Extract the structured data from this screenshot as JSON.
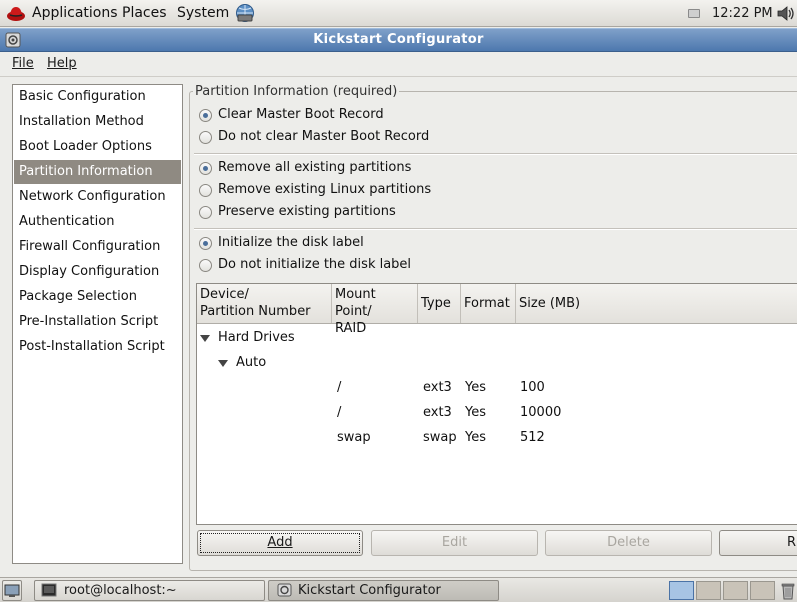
{
  "topbar": {
    "menus": [
      "Applications",
      "Places",
      "System"
    ],
    "clock": "12:22 PM"
  },
  "window": {
    "title": "Kickstart Configurator"
  },
  "menubar": {
    "file": "File",
    "help": "Help"
  },
  "sidebar": {
    "items": [
      "Basic Configuration",
      "Installation Method",
      "Boot Loader Options",
      "Partition Information",
      "Network Configuration",
      "Authentication",
      "Firewall Configuration",
      "Display Configuration",
      "Package Selection",
      "Pre-Installation Script",
      "Post-Installation Script"
    ],
    "selected": "Partition Information"
  },
  "partition": {
    "legend": "Partition Information (required)",
    "mbr": {
      "clear": "Clear Master Boot Record",
      "keep": "Do not clear Master Boot Record",
      "selected": "clear"
    },
    "existing": {
      "remove_all": "Remove all existing partitions",
      "remove_linux": "Remove existing Linux partitions",
      "preserve": "Preserve existing partitions",
      "selected": "remove_all"
    },
    "disklabel": {
      "init": "Initialize the disk label",
      "no_init": "Do not initialize the disk label",
      "selected": "init"
    },
    "table": {
      "headers": {
        "device_line1": "Device/",
        "device_line2": "Partition Number",
        "mount_line1": "Mount Point/",
        "mount_line2": "RAID",
        "type": "Type",
        "format": "Format",
        "size": "Size (MB)"
      },
      "tree": {
        "root": "Hard Drives",
        "child": "Auto"
      },
      "rows": [
        {
          "mount": "/",
          "type": "ext3",
          "format": "Yes",
          "size": "100"
        },
        {
          "mount": "/",
          "type": "ext3",
          "format": "Yes",
          "size": "10000"
        },
        {
          "mount": "swap",
          "type": "swap",
          "format": "Yes",
          "size": "512"
        }
      ]
    },
    "buttons": {
      "add": "Add",
      "edit": "Edit",
      "delete": "Delete",
      "raid": "R"
    }
  },
  "taskbar": {
    "tasks": [
      "root@localhost:~",
      "Kickstart Configurator"
    ]
  },
  "colors": {
    "titlebar": "#4d78ae",
    "selection": "#8f8a82",
    "radio_dot": "#4a6e9a"
  }
}
